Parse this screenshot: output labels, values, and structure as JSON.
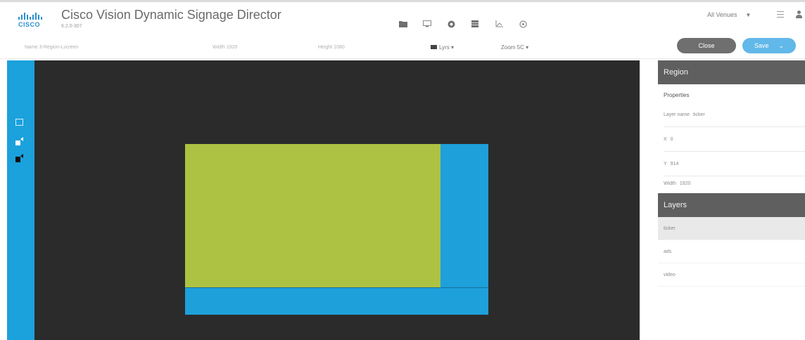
{
  "header": {
    "logo_text": "CISCO",
    "app_title": "Cisco Vision Dynamic Signage Director",
    "app_version": "6.2.0-307",
    "nav_icons": [
      "folder-icon",
      "monitor-icon",
      "gear-icon",
      "table-icon",
      "chart-icon",
      "settings-icon"
    ],
    "venue_label": "All Venues"
  },
  "toolbar": {
    "name_field": "Name  3-Region-Lscreen",
    "width_field": "Width  1920",
    "height_field": "Height  1080",
    "layers_label": "Lyrs",
    "zoom_label": "Zoom  5C",
    "close_label": "Close",
    "save_label": "Save"
  },
  "rail": {
    "icons": [
      "image-icon",
      "video-icon",
      "video-active-icon"
    ]
  },
  "canvas": {
    "colors": {
      "background": "#2b2b2b",
      "region_blue": "#1ea0db",
      "region_green": "#adc242"
    }
  },
  "panel": {
    "region_title": "Region",
    "properties_title": "Properties",
    "layer_name_label": "Layer name",
    "layer_name_value": "ticker",
    "x_label": "X",
    "x_value": "0",
    "y_label": "Y",
    "y_value": "914",
    "width_label": "Width",
    "width_value": "1920",
    "layers_title": "Layers",
    "layers": [
      {
        "label": "ticker",
        "active": true
      },
      {
        "label": "ads",
        "active": false
      },
      {
        "label": "video",
        "active": false
      }
    ]
  },
  "colors": {
    "accent": "#1ba1dc",
    "save_button": "#62b8e8",
    "close_button": "#6f6f6f",
    "panel_header": "#5f5f5f"
  }
}
